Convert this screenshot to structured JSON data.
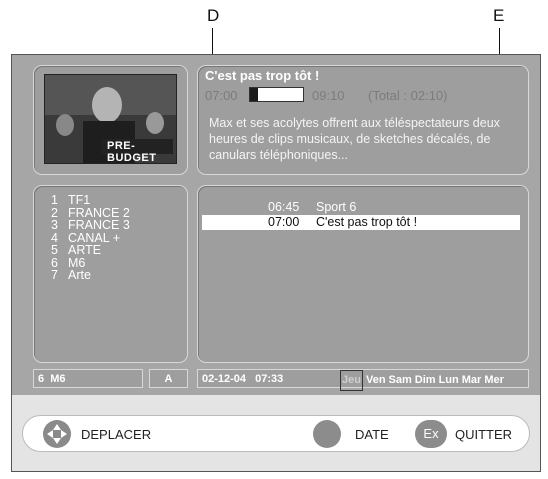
{
  "callouts": {
    "d": "D",
    "e": "E"
  },
  "program": {
    "title": "C'est pas trop tôt !",
    "start": "07:00",
    "end": "09:10",
    "total": "(Total : 02:10)",
    "progress_fraction": 0.15,
    "description": "Max et ses acolytes offrent aux téléspectateurs deux heures de clips musicaux, de sketches décalés, de canulars téléphoniques..."
  },
  "thumbnail": {
    "caption": "PRE-BUDGET"
  },
  "channels": [
    {
      "num": "1",
      "name": "TF1"
    },
    {
      "num": "2",
      "name": "FRANCE 2"
    },
    {
      "num": "3",
      "name": "FRANCE 3"
    },
    {
      "num": "4",
      "name": "CANAL +"
    },
    {
      "num": "5",
      "name": "ARTE"
    },
    {
      "num": "6",
      "name": "M6"
    },
    {
      "num": "7",
      "name": "Arte"
    }
  ],
  "guide": [
    {
      "time": "06:45",
      "name": "Sport 6",
      "selected": false
    },
    {
      "time": "07:00",
      "name": "C'est pas trop tôt !",
      "selected": true
    }
  ],
  "status": {
    "channel": "6  M6",
    "mode": "A",
    "date": "02-12-04",
    "time": "07:33",
    "days": [
      "Jeu",
      "Ven",
      "Sam",
      "Dim",
      "Lun",
      "Mar",
      "Mer"
    ],
    "selected_day": "Jeu"
  },
  "actions": {
    "move": "DEPLACER",
    "date": "DATE",
    "quit_key": "Ex",
    "quit": "QUITTER"
  },
  "colors": {
    "panel": "#9e9e9e",
    "frame": "#a6a6a6",
    "highlight": "#ffffff"
  }
}
